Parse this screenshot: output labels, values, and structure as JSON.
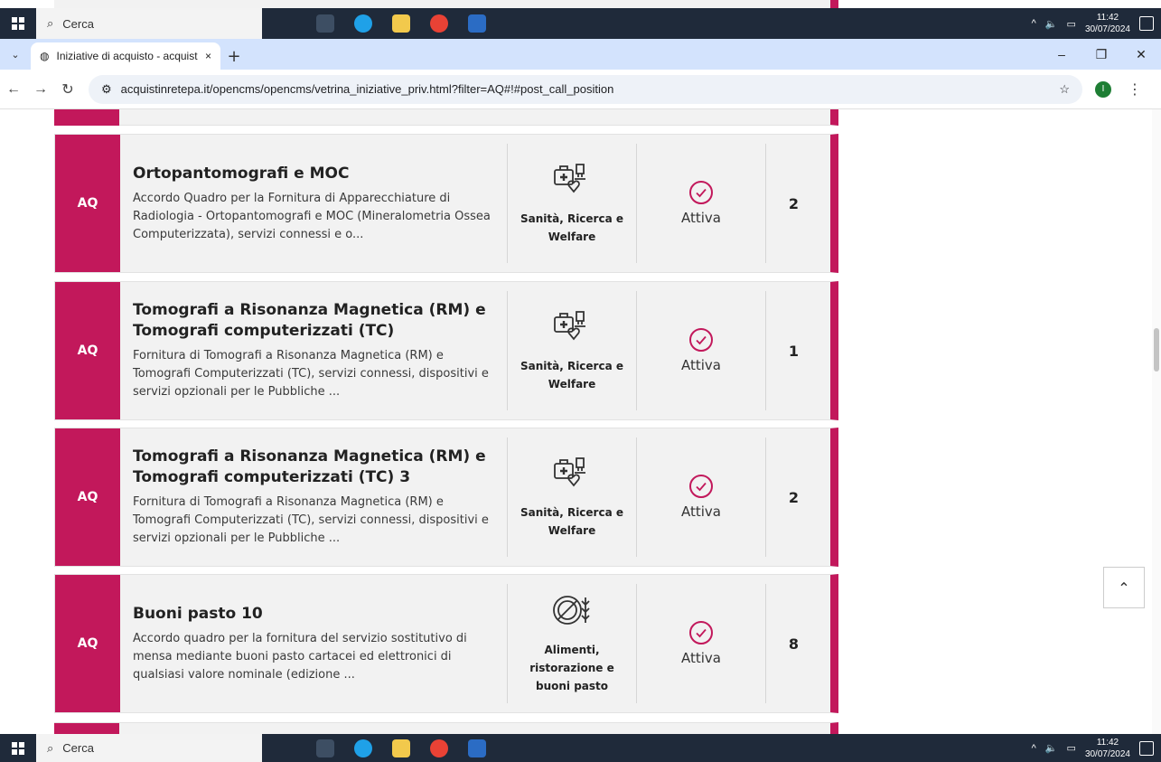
{
  "taskbar": {
    "search_placeholder": "Cerca",
    "clock_time": "11:42",
    "clock_date": "30/07/2024"
  },
  "browser": {
    "tab_title": "Iniziative di acquisto - acquistin",
    "tab_close": "×",
    "new_tab": "+",
    "url": "acquistinretepa.it/opencms/opencms/vetrina_iniziative_priv.html?filter=AQ#!#post_call_position",
    "minimize": "–",
    "restore": "❐",
    "close": "✕",
    "profile_initial": "I"
  },
  "rows": [
    {
      "badge": "AQ",
      "title": "Ortopantomografi e MOC",
      "description": "Accordo Quadro per la Fornitura di Apparecchiature di Radiologia - Ortopantomografi e MOC (Mineralometria Ossea Computerizzata), servizi connessi e o...",
      "category": "Sanità, Ricerca e Welfare",
      "category_icon": "health-icon",
      "status": "Attiva",
      "count": "2"
    },
    {
      "badge": "AQ",
      "title": "Tomografi a Risonanza Magnetica (RM) e Tomografi computerizzati (TC)",
      "description": "Fornitura di Tomografi a Risonanza Magnetica (RM) e Tomografi Computerizzati (TC), servizi connessi, dispositivi e servizi opzionali per le Pubbliche ...",
      "category": "Sanità, Ricerca e Welfare",
      "category_icon": "health-icon",
      "status": "Attiva",
      "count": "1"
    },
    {
      "badge": "AQ",
      "title": "Tomografi a Risonanza Magnetica (RM) e Tomografi computerizzati (TC) 3",
      "description": "Fornitura di Tomografi a Risonanza Magnetica (RM) e Tomografi Computerizzati (TC), servizi connessi, dispositivi e servizi opzionali per le Pubbliche ...",
      "category": "Sanità, Ricerca e Welfare",
      "category_icon": "health-icon",
      "status": "Attiva",
      "count": "2"
    },
    {
      "badge": "AQ",
      "title": "Buoni pasto 10",
      "description": "Accordo quadro per la fornitura del servizio sostitutivo di mensa mediante buoni pasto cartacei ed elettronici di qualsiasi valore nominale (edizione ...",
      "category": "Alimenti, ristorazione e buoni pasto",
      "category_icon": "food-icon",
      "status": "Attiva",
      "count": "8"
    }
  ],
  "colors": {
    "accent": "#c2185b",
    "row_bg": "#f2f2f2"
  }
}
